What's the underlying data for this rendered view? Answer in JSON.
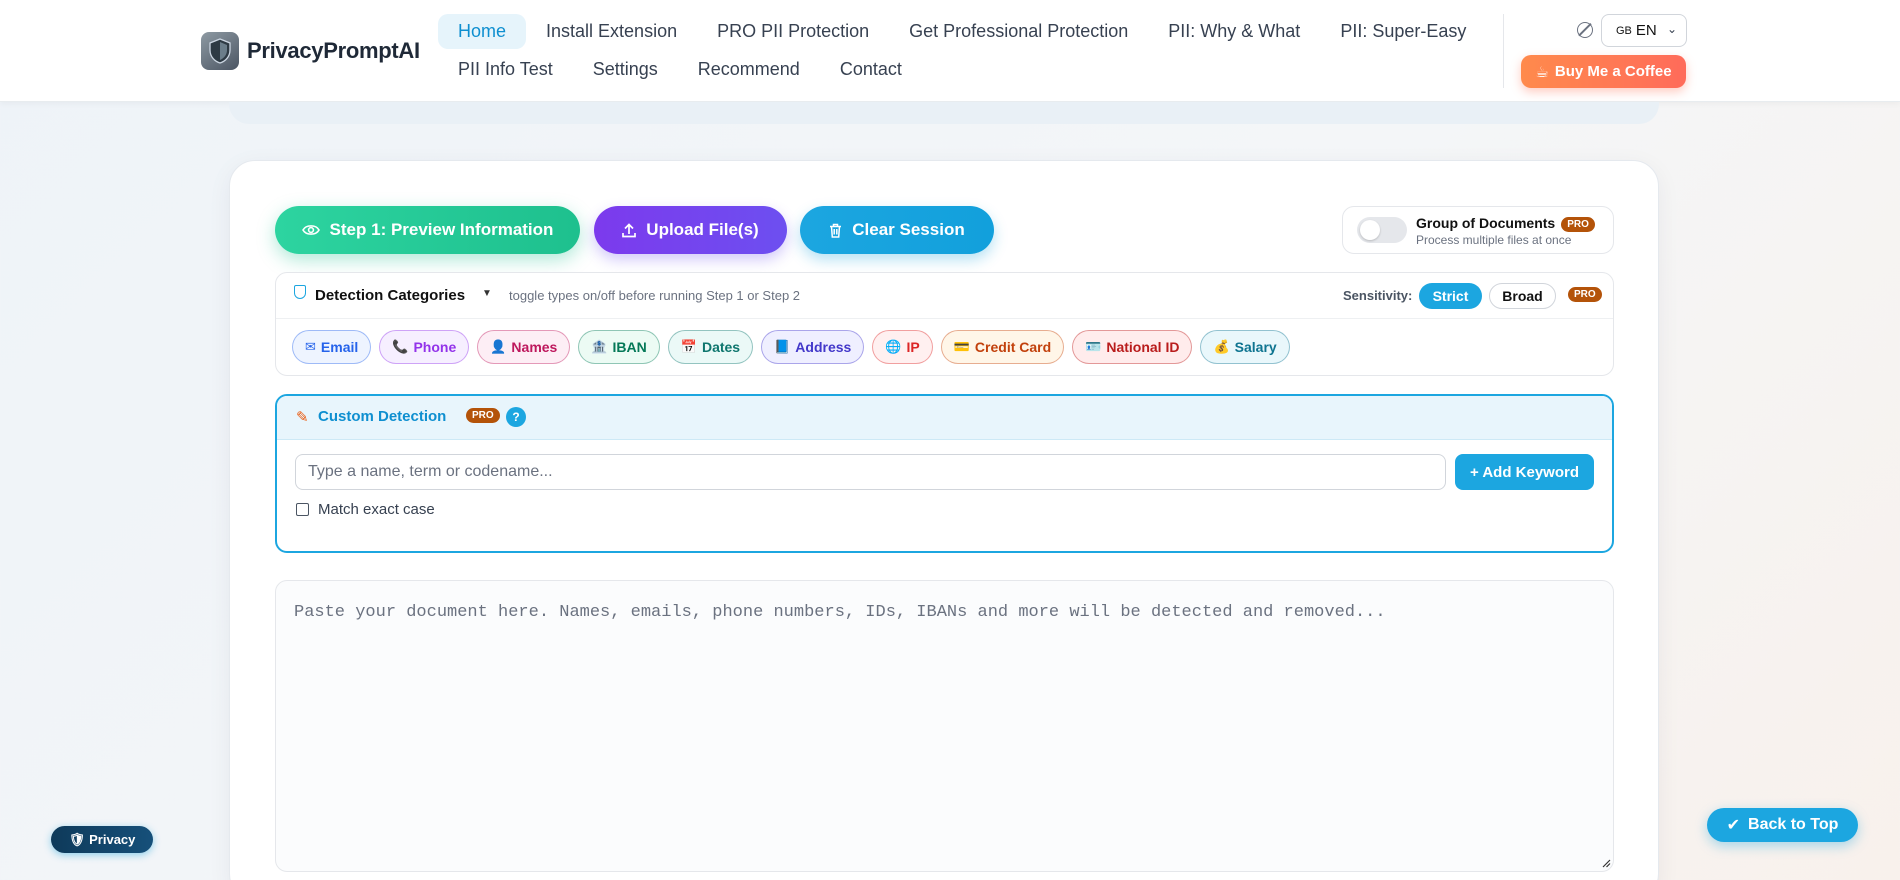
{
  "brand": {
    "name": "PrivacyPromptAI"
  },
  "nav": {
    "row1": [
      "Home",
      "Install Extension",
      "PRO PII Protection",
      "Get Professional Protection",
      "PII: Why & What",
      "PII: Super-Easy"
    ],
    "row2": [
      "PII Info Test",
      "Settings",
      "Recommend",
      "Contact"
    ]
  },
  "language": {
    "flag": "GB",
    "value": "EN"
  },
  "coffee": {
    "label": "Buy Me a Coffee",
    "icon": "coffee-cup-icon"
  },
  "actions": {
    "preview": "Step 1: Preview Information",
    "upload": "Upload File(s)",
    "clear": "Clear Session"
  },
  "group": {
    "title": "Group of Documents",
    "subtitle": "Process multiple files at once",
    "badge": "PRO"
  },
  "detection": {
    "title": "Detection Categories",
    "hint": "toggle types on/off before running Step 1 or Step 2",
    "sensitivity_label": "Sensitivity:",
    "strict": "Strict",
    "broad": "Broad",
    "badge": "PRO",
    "chips": [
      {
        "label": "Email",
        "icon": "✉",
        "color": "#2563eb",
        "bg": "#eef4ff"
      },
      {
        "label": "Phone",
        "icon": "📞",
        "color": "#9333ea",
        "bg": "#f6efff"
      },
      {
        "label": "Names",
        "icon": "👤",
        "color": "#be185d",
        "bg": "#fdeef5"
      },
      {
        "label": "IBAN",
        "icon": "🏦",
        "color": "#047857",
        "bg": "#ecfbf4"
      },
      {
        "label": "Dates",
        "icon": "📅",
        "color": "#0f766e",
        "bg": "#ebf9f7"
      },
      {
        "label": "Address",
        "icon": "📘",
        "color": "#4338ca",
        "bg": "#efefff"
      },
      {
        "label": "IP",
        "icon": "🌐",
        "color": "#dc2626",
        "bg": "#fff0f0"
      },
      {
        "label": "Credit Card",
        "icon": "💳",
        "color": "#c2410c",
        "bg": "#fff6e8"
      },
      {
        "label": "National ID",
        "icon": "🪪",
        "color": "#b91c1c",
        "bg": "#ffecec"
      },
      {
        "label": "Salary",
        "icon": "💰",
        "color": "#0e7490",
        "bg": "#e9f7fb"
      }
    ]
  },
  "custom": {
    "title": "Custom Detection",
    "badge": "PRO",
    "help": "?",
    "input_placeholder": "Type a name, term or codename...",
    "add_label": "+ Add Keyword",
    "match_label": "Match exact case"
  },
  "document": {
    "placeholder": "Paste your document here. Names, emails, phone numbers, IDs, IBANs and more will be detected and removed..."
  },
  "floating": {
    "privacy": "Privacy",
    "back_top": "Back to Top"
  },
  "colors": {
    "accent": "#1ca6e0",
    "preview": "#1ec08e",
    "upload": "#6d4ff0",
    "pro": "#b45309",
    "coffee": "#ff7a50"
  }
}
